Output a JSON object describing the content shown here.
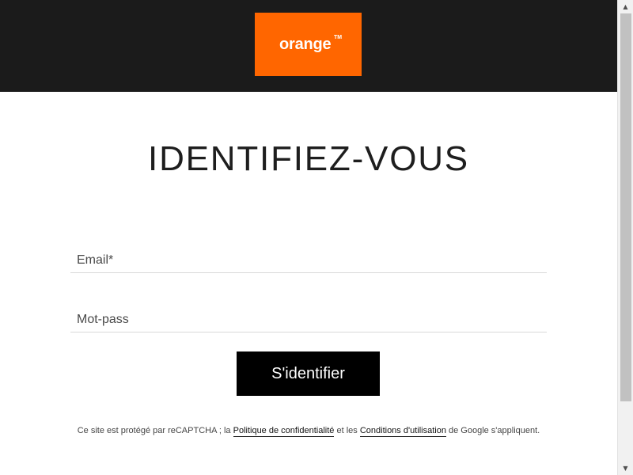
{
  "header": {
    "logo_text": "orange",
    "logo_trademark": "TM",
    "background_color": "#1b1b1b",
    "logo_color": "#ff6600"
  },
  "login": {
    "title": "IDENTIFIEZ-VOUS",
    "email_placeholder": "Email*",
    "email_value": "",
    "password_placeholder": "Mot-pass",
    "password_value": "",
    "submit_label": "S'identifier"
  },
  "recaptcha_notice": {
    "prefix": "Ce site est protégé par reCAPTCHA ; la ",
    "privacy_link": "Politique de confidentialité",
    "middle": " et les ",
    "terms_link": "Conditions d'utilisation",
    "suffix": " de Google s'appliquent."
  },
  "scrollbar": {
    "up_icon": "scroll-up-arrow-icon",
    "down_icon": "scroll-down-arrow-icon"
  }
}
